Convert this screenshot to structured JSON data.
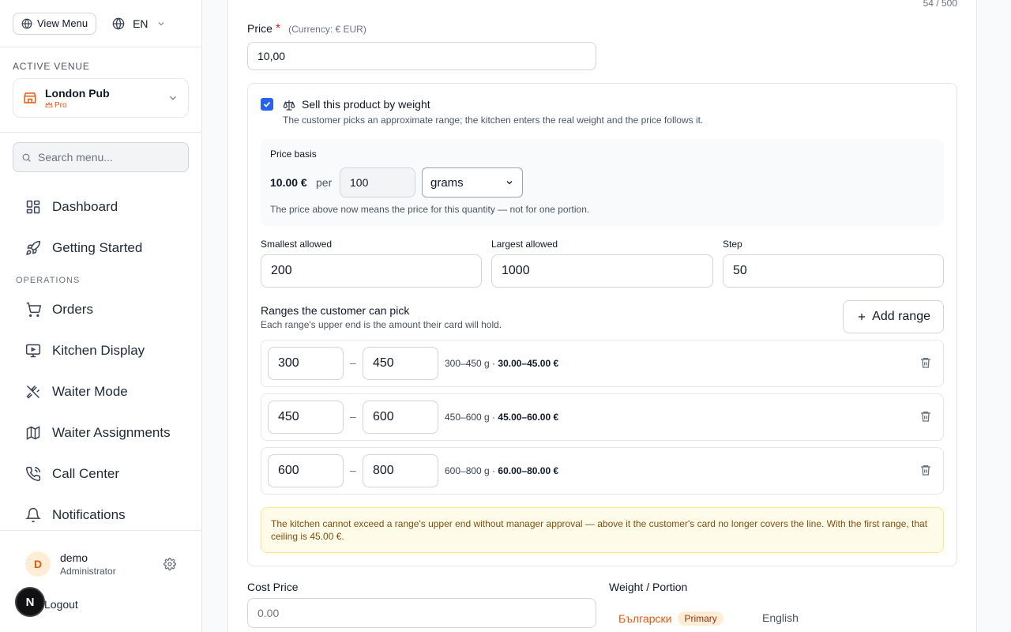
{
  "header": {
    "view_menu_label": "View Menu",
    "language": "EN"
  },
  "venue": {
    "section_label": "ACTIVE VENUE",
    "name": "London Pub",
    "plan": "Pro"
  },
  "search": {
    "placeholder": "Search menu..."
  },
  "nav": {
    "top_items": [
      {
        "label": "Dashboard",
        "icon": "dashboard-icon"
      },
      {
        "label": "Getting Started",
        "icon": "rocket-icon"
      }
    ],
    "section_label": "OPERATIONS",
    "ops_items": [
      {
        "label": "Orders",
        "icon": "cart-icon"
      },
      {
        "label": "Kitchen Display",
        "icon": "monitor-icon"
      },
      {
        "label": "Waiter Mode",
        "icon": "utensils-icon"
      },
      {
        "label": "Waiter Assignments",
        "icon": "map-icon"
      },
      {
        "label": "Call Center",
        "icon": "phone-icon"
      },
      {
        "label": "Notifications",
        "icon": "bell-icon"
      }
    ]
  },
  "user": {
    "initial": "D",
    "name": "demo",
    "role": "Administrator",
    "logout_label": "Logout"
  },
  "dev_badge": "N",
  "form": {
    "char_count": "54 / 500",
    "price": {
      "label": "Price",
      "required_mark": "*",
      "currency_note": "(Currency: € EUR)",
      "value": "10,00"
    },
    "weight": {
      "checkbox_label": "Sell this product by weight",
      "checked": true,
      "description": "The customer picks an approximate range; the kitchen enters the real weight and the price follows it.",
      "basis": {
        "title": "Price basis",
        "price_text": "10.00 €",
        "per_label": "per",
        "quantity": "100",
        "unit_selected": "grams",
        "note": "The price above now means the price for this quantity — not for one portion."
      },
      "limits": {
        "smallest_label": "Smallest allowed",
        "smallest_value": "200",
        "largest_label": "Largest allowed",
        "largest_value": "1000",
        "step_label": "Step",
        "step_value": "50"
      },
      "ranges_title": "Ranges the customer can pick",
      "ranges_subtitle": "Each range's upper end is the amount their card will hold.",
      "add_range_label": "Add range",
      "ranges": [
        {
          "from": "300",
          "to": "450",
          "summary": "300–450 g · ",
          "price": "30.00–45.00 €"
        },
        {
          "from": "450",
          "to": "600",
          "summary": "450–600 g · ",
          "price": "45.00–60.00 €"
        },
        {
          "from": "600",
          "to": "800",
          "summary": "600–800 g · ",
          "price": "60.00–80.00 €"
        }
      ],
      "range_dash": "–",
      "warning": "The kitchen cannot exceed a range's upper end without manager approval — above it the customer's card no longer covers the line. With the first range, that ceiling is 45.00 €."
    },
    "cost_price": {
      "label": "Cost Price",
      "placeholder": "0.00"
    },
    "weight_portion": {
      "label": "Weight / Portion",
      "tab_bg": "Български",
      "tab_bg_badge": "Primary",
      "tab_en": "English"
    }
  },
  "colors": {
    "accent": "#ea580c",
    "primary_blue": "#2563eb",
    "warning_bg": "#fefce8",
    "warning_text": "#854d0e"
  }
}
